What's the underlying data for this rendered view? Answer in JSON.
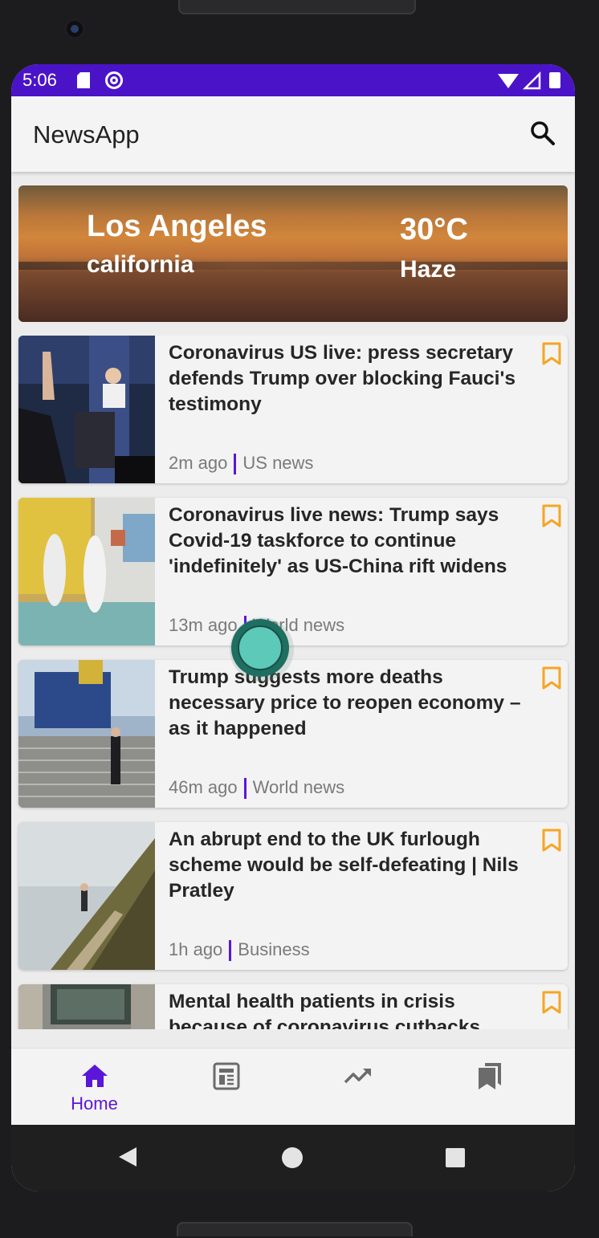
{
  "status_bar": {
    "time": "5:06",
    "color": "#4b13c8"
  },
  "app_bar": {
    "title": "NewsApp",
    "search_icon": "search-icon"
  },
  "weather": {
    "city": "Los Angeles",
    "region": "california",
    "temperature": "30°C",
    "condition": "Haze"
  },
  "articles": [
    {
      "title": "Coronavirus US live: press secretary defends Trump over blocking Fauci's testimony",
      "time": "2m ago",
      "section": "US news",
      "image": "press-briefing-thumbnail"
    },
    {
      "title": "Coronavirus live news: Trump says Covid-19 taskforce to continue 'indefinitely' as US-China rift widens",
      "time": "13m ago",
      "section": "World news",
      "image": "disinfection-workers-thumbnail"
    },
    {
      "title": "Trump suggests more deaths necessary price to reopen economy – as it happened",
      "time": "46m ago",
      "section": "World news",
      "image": "future-sign-stairs-thumbnail"
    },
    {
      "title": "An abrupt end to the UK furlough scheme would be self-defeating | Nils Pratley",
      "time": "1h ago",
      "section": "Business",
      "image": "cliff-path-fog-thumbnail"
    },
    {
      "title": "Mental health patients in crisis because of coronavirus cutbacks",
      "time": "",
      "section": "",
      "image": "building-window-thumbnail"
    }
  ],
  "bottom_nav": [
    {
      "label": "Home",
      "icon": "home-icon",
      "active": true
    },
    {
      "label": "",
      "icon": "newspaper-icon",
      "active": false
    },
    {
      "label": "",
      "icon": "trending-icon",
      "active": false
    },
    {
      "label": "",
      "icon": "bookmarks-icon",
      "active": false
    }
  ],
  "colors": {
    "accent": "#5b16d8",
    "bookmark": "#f5a623"
  }
}
